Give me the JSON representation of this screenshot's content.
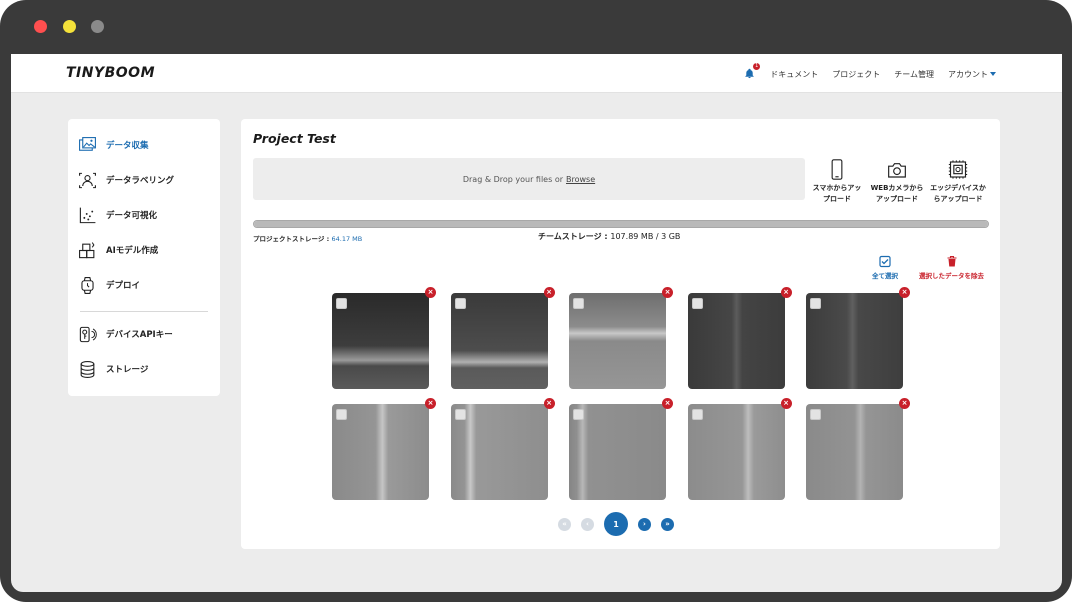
{
  "app": {
    "logo": "TINYBOOM",
    "notifications_count": "1"
  },
  "topnav": {
    "items": [
      "ドキュメント",
      "プロジェクト",
      "チーム管理",
      "アカウント"
    ]
  },
  "sidebar": {
    "items": [
      {
        "label": "データ収集",
        "icon": "image-gallery-icon",
        "active": true
      },
      {
        "label": "データラベリング",
        "icon": "label-frame-icon",
        "active": false
      },
      {
        "label": "データ可視化",
        "icon": "scatter-plot-icon",
        "active": false
      },
      {
        "label": "AIモデル作成",
        "icon": "ai-model-icon",
        "active": false
      },
      {
        "label": "デプロイ",
        "icon": "smartwatch-icon",
        "active": false
      },
      {
        "label": "デバイスAPIキー",
        "icon": "device-key-icon",
        "active": false
      },
      {
        "label": "ストレージ",
        "icon": "database-icon",
        "active": false
      }
    ]
  },
  "main": {
    "project_title": "Project Test",
    "dropzone": {
      "text": "Drag & Drop your files or",
      "link": "Browse"
    },
    "upload_options": [
      {
        "line1": "スマホからアッ",
        "line2": "プロード",
        "icon": "smartphone-icon"
      },
      {
        "line1": "WEBカメラから",
        "line2": "アップロード",
        "icon": "camera-icon"
      },
      {
        "line1": "エッジデバイスか",
        "line2": "らアップロード",
        "icon": "edge-device-icon"
      }
    ],
    "storage": {
      "usage_fraction": 1.0,
      "project_label": "プロジェクトストレージ : ",
      "project_value": "64.17 MB",
      "team_label": "チームストレージ : ",
      "team_value": "107.89 MB",
      "team_total": "3 GB"
    },
    "actions": {
      "select_all": "全て選択",
      "delete_selected": "選択したデータを除去"
    },
    "pagination": {
      "current_page": "1"
    }
  },
  "colors": {
    "accent": "#1c6cb0",
    "danger": "#c8202a",
    "window_frame": "#3a3a3a"
  }
}
